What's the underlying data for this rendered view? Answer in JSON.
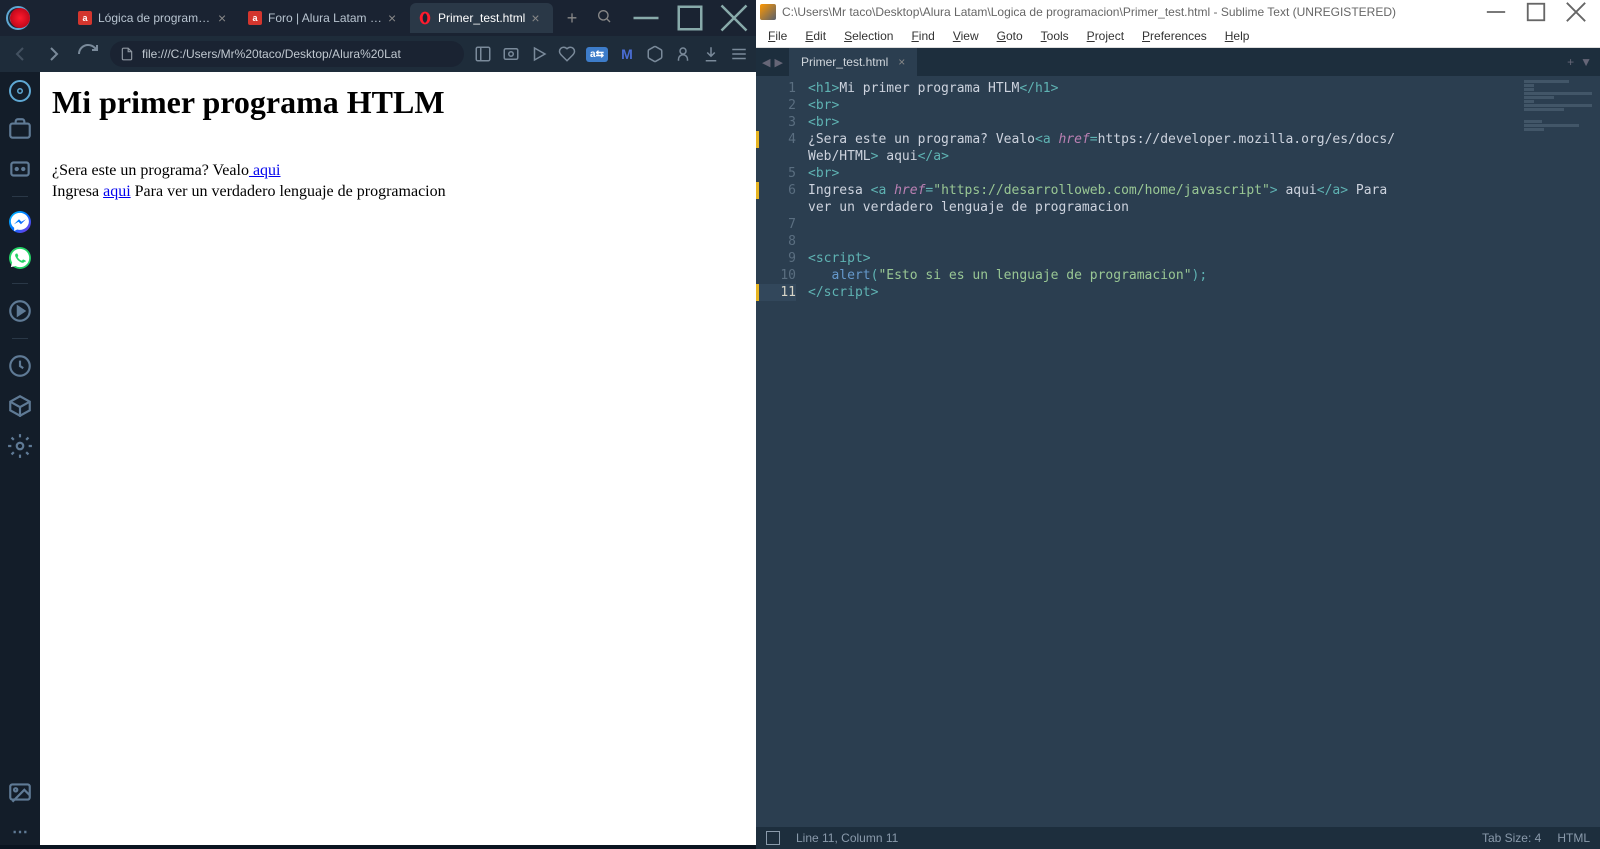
{
  "browser": {
    "tabs": [
      {
        "favicon": "a",
        "title": "Lógica de programació"
      },
      {
        "favicon": "a",
        "title": "Foro | Alura Latam - Cu"
      },
      {
        "favicon": "opera",
        "title": "Primer_test.html"
      }
    ],
    "active_tab": 2,
    "address": "file:///C:/Users/Mr%20taco/Desktop/Alura%20Lat",
    "page": {
      "heading": "Mi primer programa HTLM",
      "line1_a": "¿Sera este un programa? Vealo",
      "line1_link": " aqui",
      "line2_a": "Ingresa ",
      "line2_link": "aqui",
      "line2_b": " Para ver un verdadero lenguaje de programacion"
    },
    "translate_badge": "a⇆"
  },
  "editor": {
    "title": "C:\\Users\\Mr taco\\Desktop\\Alura Latam\\Logica de programacion\\Primer_test.html - Sublime Text (UNREGISTERED)",
    "menu": [
      "File",
      "Edit",
      "Selection",
      "Find",
      "View",
      "Goto",
      "Tools",
      "Project",
      "Preferences",
      "Help"
    ],
    "tab": "Primer_test.html",
    "lines": [
      {
        "n": 1,
        "seg": [
          [
            "<",
            "p"
          ],
          [
            "h1",
            "t"
          ],
          [
            ">",
            "p"
          ],
          [
            "Mi primer programa HTLM",
            "tx"
          ],
          [
            "</",
            "p"
          ],
          [
            "h1",
            "t"
          ],
          [
            ">",
            "p"
          ]
        ]
      },
      {
        "n": 2,
        "seg": [
          [
            "<",
            "p"
          ],
          [
            "br",
            "t"
          ],
          [
            ">",
            "p"
          ]
        ]
      },
      {
        "n": 3,
        "seg": [
          [
            "<",
            "p"
          ],
          [
            "br",
            "t"
          ],
          [
            ">",
            "p"
          ]
        ]
      },
      {
        "n": 4,
        "seg": [
          [
            "¿Sera este un programa? Vealo",
            "tx"
          ],
          [
            "<",
            "p"
          ],
          [
            "a",
            "t"
          ],
          [
            " ",
            "tx"
          ],
          [
            "href",
            "a"
          ],
          [
            "=",
            "p"
          ],
          [
            "https://developer.mozilla.org/es/docs/",
            "tx"
          ]
        ]
      },
      {
        "n": "",
        "seg": [
          [
            "Web/HTML",
            "tx"
          ],
          [
            ">",
            "p"
          ],
          [
            " aqui",
            "tx"
          ],
          [
            "</",
            "p"
          ],
          [
            "a",
            "t"
          ],
          [
            ">",
            "p"
          ]
        ]
      },
      {
        "n": 5,
        "seg": [
          [
            "<",
            "p"
          ],
          [
            "br",
            "t"
          ],
          [
            ">",
            "p"
          ]
        ]
      },
      {
        "n": 6,
        "seg": [
          [
            "Ingresa ",
            "tx"
          ],
          [
            "<",
            "p"
          ],
          [
            "a",
            "t"
          ],
          [
            " ",
            "tx"
          ],
          [
            "href",
            "a"
          ],
          [
            "=",
            "p"
          ],
          [
            "\"https://desarrolloweb.com/home/javascript\"",
            "s"
          ],
          [
            ">",
            "p"
          ],
          [
            " aqui",
            "tx"
          ],
          [
            "</",
            "p"
          ],
          [
            "a",
            "t"
          ],
          [
            ">",
            "p"
          ],
          [
            " Para ",
            "tx"
          ]
        ]
      },
      {
        "n": "",
        "seg": [
          [
            "ver un verdadero lenguaje de programacion",
            "tx"
          ]
        ]
      },
      {
        "n": 7,
        "seg": []
      },
      {
        "n": 8,
        "seg": []
      },
      {
        "n": 9,
        "seg": [
          [
            "<",
            "p"
          ],
          [
            "script",
            "t"
          ],
          [
            ">",
            "p"
          ]
        ]
      },
      {
        "n": 10,
        "seg": [
          [
            "   ",
            "tx"
          ],
          [
            "alert",
            "f"
          ],
          [
            "(",
            "p"
          ],
          [
            "\"Esto si es un lenguaje de programacion\"",
            "s"
          ],
          [
            ");",
            "p"
          ]
        ]
      },
      {
        "n": 11,
        "hl": true,
        "seg": [
          [
            "</",
            "p"
          ],
          [
            "script",
            "t"
          ],
          [
            ">",
            "p"
          ]
        ]
      }
    ],
    "marked_lines": [
      4,
      6,
      11
    ],
    "status": {
      "pos": "Line 11, Column 11",
      "tab_size": "Tab Size: 4",
      "syntax": "HTML"
    }
  }
}
